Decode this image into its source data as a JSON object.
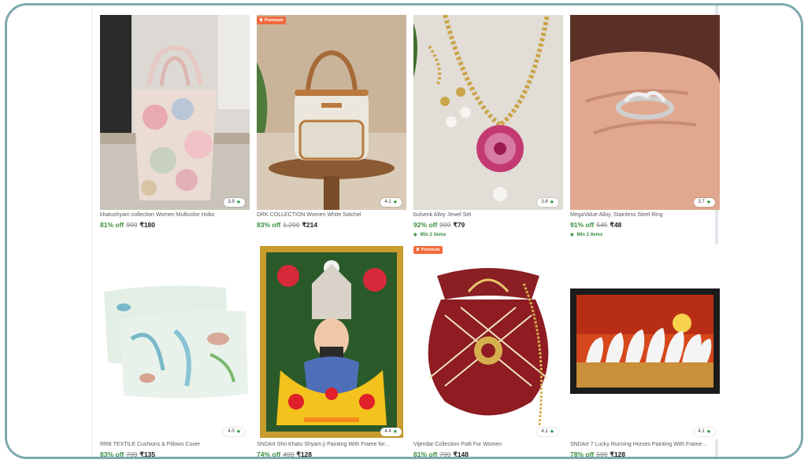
{
  "products": [
    {
      "title": "khatushyam collection Women Multicolor Hobo",
      "rating": "3.9",
      "discount": "81% off",
      "mrp": "999",
      "price": "₹180",
      "icon": "handbag-image"
    },
    {
      "title": "DRK COLLECTION Women White Satchel",
      "rating": "4.1",
      "discount": "83% off",
      "mrp": "1,299",
      "price": "₹214",
      "badge": "Premium",
      "icon": "satchel-image"
    },
    {
      "title": "bulsenk Alloy Jewel Set",
      "rating": "3.8",
      "discount": "92% off",
      "mrp": "999",
      "price": "₹79",
      "min_items": "Min 2 items",
      "icon": "jewel-set-image"
    },
    {
      "title": "MegaValue Alloy, Stainless Steel Ring",
      "rating": "3.7",
      "discount": "91% off",
      "mrp": "545",
      "price": "₹48",
      "min_items": "Min 2 items",
      "icon": "ring-image"
    },
    {
      "title": "RRB TEXTILE Cushions & Pillows Cover",
      "rating": "4.0",
      "discount": "83% off",
      "mrp": "799",
      "price": "₹135",
      "icon": "pillow-cover-image"
    },
    {
      "title": "SNDArt Shri Khatu Shyam ji Painting With Frame for...",
      "rating": "4.4",
      "discount": "74% off",
      "mrp": "499",
      "price": "₹128",
      "icon": "framed-painting-image"
    },
    {
      "title": "Vijendar Collection Potli For Women",
      "rating": "4.1",
      "discount": "81% off",
      "mrp": "799",
      "price": "₹148",
      "badge": "Premium",
      "icon": "potli-bag-image"
    },
    {
      "title": "SNDArt 7 Lucky Running Horses Painting With Frame...",
      "rating": "4.1",
      "discount": "78% off",
      "mrp": "599",
      "price": "₹128",
      "icon": "horses-painting-image"
    }
  ],
  "colors": {
    "discount": "#388e3c",
    "premium": "#f26a3d",
    "frame": "#7fa9b0"
  }
}
